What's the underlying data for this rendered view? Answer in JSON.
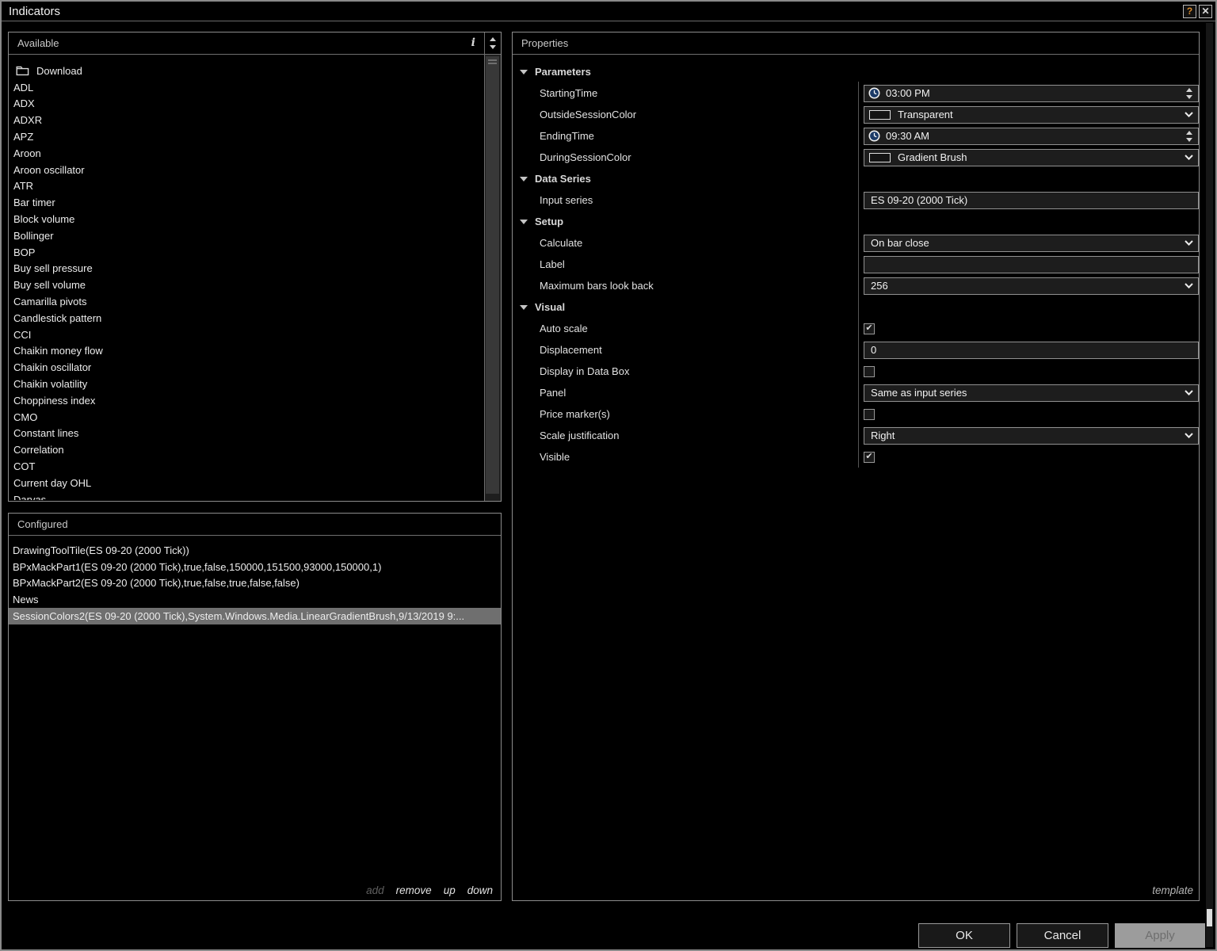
{
  "window": {
    "title": "Indicators"
  },
  "icons": {
    "help": "?",
    "close": "✕",
    "info": "i",
    "check": "✔"
  },
  "colors": {
    "selected_row": "#6f6f6f",
    "clock_fill": "#1b3a67",
    "help_glyph": "#d78a2e"
  },
  "available": {
    "header": "Available",
    "download_label": "Download",
    "items": [
      "ADL",
      "ADX",
      "ADXR",
      "APZ",
      "Aroon",
      "Aroon oscillator",
      "ATR",
      "Bar timer",
      "Block volume",
      "Bollinger",
      "BOP",
      "Buy sell pressure",
      "Buy sell volume",
      "Camarilla pivots",
      "Candlestick pattern",
      "CCI",
      "Chaikin money flow",
      "Chaikin oscillator",
      "Chaikin volatility",
      "Choppiness index",
      "CMO",
      "Constant lines",
      "Correlation",
      "COT",
      "Current day OHL",
      "Darvas"
    ]
  },
  "configured": {
    "header": "Configured",
    "items": [
      {
        "label": "DrawingToolTile(ES 09-20 (2000 Tick))",
        "selected": false
      },
      {
        "label": "BPxMackPart1(ES 09-20 (2000 Tick),true,false,150000,151500,93000,150000,1)",
        "selected": false
      },
      {
        "label": "BPxMackPart2(ES 09-20 (2000 Tick),true,false,true,false,false)",
        "selected": false
      },
      {
        "label": "News",
        "selected": false
      },
      {
        "label": "SessionColors2(ES 09-20 (2000 Tick),System.Windows.Media.LinearGradientBrush,9/13/2019 9:...",
        "selected": true
      }
    ],
    "actions": {
      "add": "add",
      "remove": "remove",
      "up": "up",
      "down": "down"
    }
  },
  "properties": {
    "header": "Properties",
    "template_label": "template",
    "sections": [
      {
        "title": "Parameters",
        "rows": [
          {
            "label": "StartingTime",
            "control": "time",
            "value": "03:00 PM"
          },
          {
            "label": "OutsideSessionColor",
            "control": "color",
            "value": "Transparent"
          },
          {
            "label": "EndingTime",
            "control": "time",
            "value": "09:30 AM"
          },
          {
            "label": "DuringSessionColor",
            "control": "color",
            "value": "Gradient Brush"
          }
        ]
      },
      {
        "title": "Data Series",
        "rows": [
          {
            "label": "Input series",
            "control": "text",
            "value": "ES 09-20 (2000 Tick)"
          }
        ]
      },
      {
        "title": "Setup",
        "rows": [
          {
            "label": "Calculate",
            "control": "select",
            "value": "On bar close"
          },
          {
            "label": "Label",
            "control": "text",
            "value": ""
          },
          {
            "label": "Maximum bars look back",
            "control": "select",
            "value": "256"
          }
        ]
      },
      {
        "title": "Visual",
        "rows": [
          {
            "label": "Auto scale",
            "control": "checkbox",
            "checked": true
          },
          {
            "label": "Displacement",
            "control": "text",
            "value": "0"
          },
          {
            "label": "Display in Data Box",
            "control": "checkbox",
            "checked": false
          },
          {
            "label": "Panel",
            "control": "select",
            "value": "Same as input series"
          },
          {
            "label": "Price marker(s)",
            "control": "checkbox",
            "checked": false
          },
          {
            "label": "Scale justification",
            "control": "select",
            "value": "Right"
          },
          {
            "label": "Visible",
            "control": "checkbox",
            "checked": true
          }
        ]
      }
    ]
  },
  "footer": {
    "ok_label": "OK",
    "cancel_label": "Cancel",
    "apply_label": "Apply"
  }
}
